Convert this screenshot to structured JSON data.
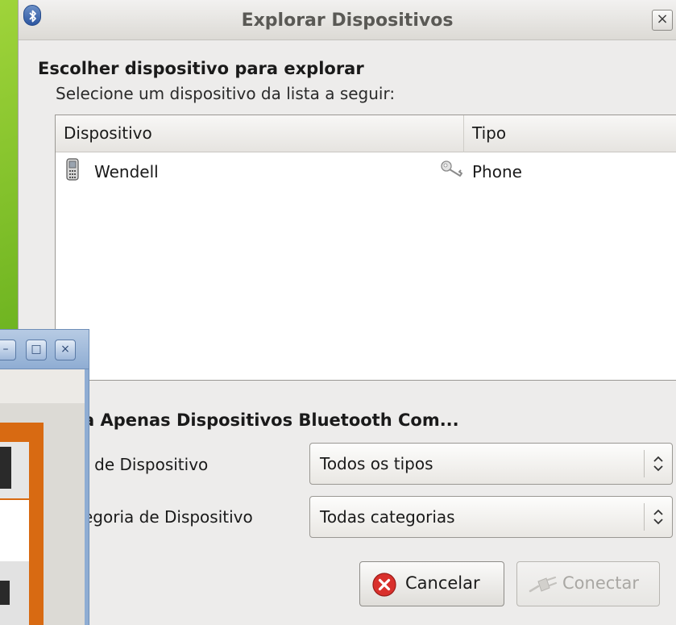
{
  "window": {
    "title": "Explorar Dispositivos",
    "close_label": "×"
  },
  "section": {
    "heading": "Escolher dispositivo para explorar",
    "instruction": "Selecione um dispositivo da lista a seguir:"
  },
  "device_list": {
    "columns": [
      "Dispositivo",
      "Tipo"
    ],
    "rows": [
      {
        "name": "Wendell",
        "type": "Phone",
        "icon": "phone-icon",
        "paired_icon": "key-icon"
      }
    ]
  },
  "filter": {
    "heading": "a Apenas Dispositivos Bluetooth Com...",
    "type_label": ") de Dispositivo",
    "type_value": "Todos os tipos",
    "category_label": "egoria de Dispositivo",
    "category_value": "Todas categorias"
  },
  "buttons": {
    "cancel_label": "Cancelar",
    "connect_label": "Conectar"
  },
  "background_window": {
    "min_label": "–",
    "max_label": "□",
    "close_label": "×"
  },
  "colors": {
    "desktop": "#6db320",
    "dialog_bg": "#edeceb",
    "bg_window_accent": "#8fadd3",
    "orange_panel": "#d86a12",
    "cancel_red": "#d9302c"
  }
}
